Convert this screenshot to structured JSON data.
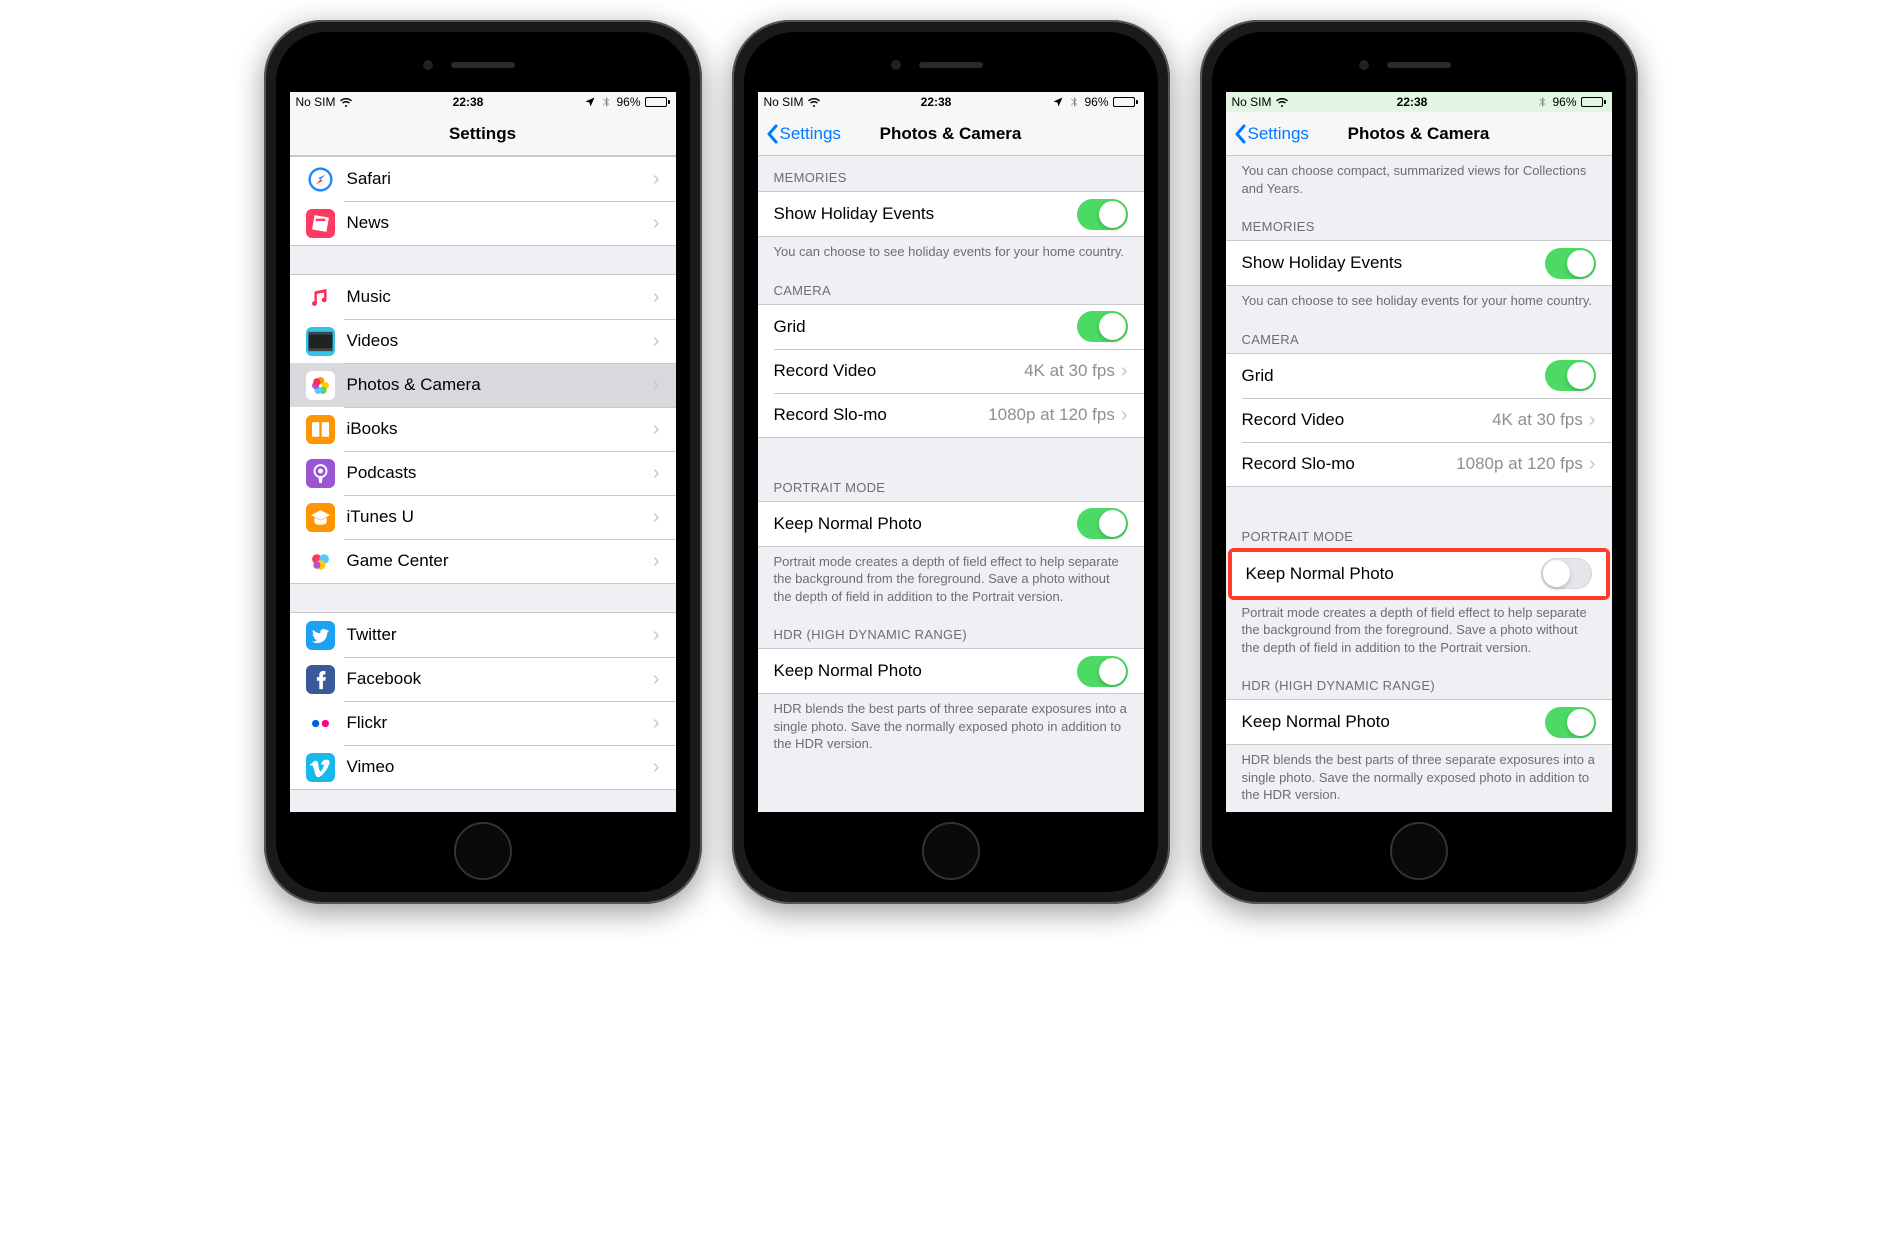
{
  "status": {
    "carrier": "No SIM",
    "time": "22:38",
    "battery": "96%"
  },
  "phone1": {
    "title": "Settings",
    "groups": [
      [
        {
          "icon": "safari",
          "label": "Safari",
          "color": "#fff",
          "iconColor": "#1e88ff"
        },
        {
          "icon": "news",
          "label": "News",
          "color": "#ff3b62"
        }
      ],
      [
        {
          "icon": "music",
          "label": "Music",
          "color": "#fff",
          "iconColor": "#ff2d55"
        },
        {
          "icon": "videos",
          "label": "Videos",
          "color": "#32c3e8"
        },
        {
          "icon": "photos",
          "label": "Photos & Camera",
          "color": "#fff",
          "selected": true
        },
        {
          "icon": "ibooks",
          "label": "iBooks",
          "color": "#ff9500"
        },
        {
          "icon": "podcasts",
          "label": "Podcasts",
          "color": "#9a55d3"
        },
        {
          "icon": "itunesu",
          "label": "iTunes U",
          "color": "#ff9500"
        },
        {
          "icon": "gamecenter",
          "label": "Game Center",
          "color": "#fff"
        }
      ],
      [
        {
          "icon": "twitter",
          "label": "Twitter",
          "color": "#1da1f2"
        },
        {
          "icon": "facebook",
          "label": "Facebook",
          "color": "#3b5998"
        },
        {
          "icon": "flickr",
          "label": "Flickr",
          "color": "#fff"
        },
        {
          "icon": "vimeo",
          "label": "Vimeo",
          "color": "#1ab7ea"
        }
      ]
    ]
  },
  "phone2": {
    "back": "Settings",
    "title": "Photos & Camera",
    "sections": {
      "memories_header": "MEMORIES",
      "show_holiday": "Show Holiday Events",
      "holiday_footer": "You can choose to see holiday events for your home country.",
      "camera_header": "CAMERA",
      "grid": "Grid",
      "record_video": "Record Video",
      "record_video_val": "4K at 30 fps",
      "record_slomo": "Record Slo-mo",
      "record_slomo_val": "1080p at 120 fps",
      "portrait_header": "PORTRAIT MODE",
      "keep_normal_portrait": "Keep Normal Photo",
      "portrait_footer": "Portrait mode creates a depth of field effect to help separate the background from the foreground. Save a photo without the depth of field in addition to the Portrait version.",
      "hdr_header": "HDR (HIGH DYNAMIC RANGE)",
      "keep_normal_hdr": "Keep Normal Photo",
      "hdr_footer": "HDR blends the best parts of three separate exposures into a single photo. Save the normally exposed photo in addition to the HDR version."
    }
  },
  "phone3": {
    "back": "Settings",
    "title": "Photos & Camera",
    "top_footer": "You can choose compact, summarized views for Collections and Years.",
    "sections": {
      "memories_header": "MEMORIES",
      "show_holiday": "Show Holiday Events",
      "holiday_footer": "You can choose to see holiday events for your home country.",
      "camera_header": "CAMERA",
      "grid": "Grid",
      "record_video": "Record Video",
      "record_video_val": "4K at 30 fps",
      "record_slomo": "Record Slo-mo",
      "record_slomo_val": "1080p at 120 fps",
      "portrait_header": "PORTRAIT MODE",
      "keep_normal_portrait": "Keep Normal Photo",
      "portrait_footer": "Portrait mode creates a depth of field effect to help separate the background from the foreground. Save a photo without the depth of field in addition to the Portrait version.",
      "hdr_header": "HDR (HIGH DYNAMIC RANGE)",
      "keep_normal_hdr": "Keep Normal Photo",
      "hdr_footer": "HDR blends the best parts of three separate exposures into a single photo. Save the normally exposed photo in addition to the HDR version."
    }
  }
}
